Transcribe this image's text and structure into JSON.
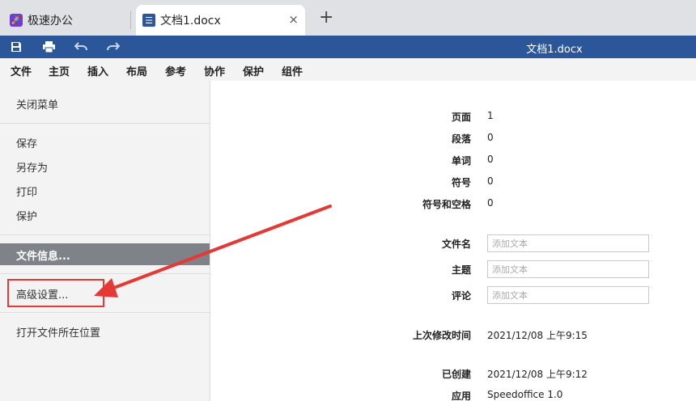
{
  "tabs": {
    "home_label": "极速办公",
    "doc_label": "文档1.docx",
    "close_symbol": "×",
    "new_tab_symbol": "+"
  },
  "titlebar": {
    "title": "文档1.docx"
  },
  "menu": [
    "文件",
    "主页",
    "插入",
    "布局",
    "参考",
    "协作",
    "保护",
    "组件"
  ],
  "sidebar": {
    "close_menu": "关闭菜单",
    "save": "保存",
    "save_as": "另存为",
    "print": "打印",
    "protect": "保护",
    "file_info": "文件信息...",
    "advanced": "高级设置...",
    "open_location": "打开文件所在位置"
  },
  "info": {
    "stats": [
      {
        "label": "页面",
        "value": "1"
      },
      {
        "label": "段落",
        "value": "0"
      },
      {
        "label": "单词",
        "value": "0"
      },
      {
        "label": "符号",
        "value": "0"
      },
      {
        "label": "符号和空格",
        "value": "0"
      }
    ],
    "fields": [
      {
        "label": "文件名",
        "placeholder": "添加文本"
      },
      {
        "label": "主题",
        "placeholder": "添加文本"
      },
      {
        "label": "评论",
        "placeholder": "添加文本"
      }
    ],
    "modified_label": "上次修改时间",
    "modified_value": "2021/12/08 上午9:15",
    "created_label": "已创建",
    "created_value": "2021/12/08 上午9:12",
    "app_label": "应用",
    "app_value": "Speedoffice 1.0"
  },
  "colors": {
    "brand": "#2b579a",
    "accent_app": "#6a3fd1",
    "annotation": "#e53935",
    "active_item": "#7f8389"
  }
}
